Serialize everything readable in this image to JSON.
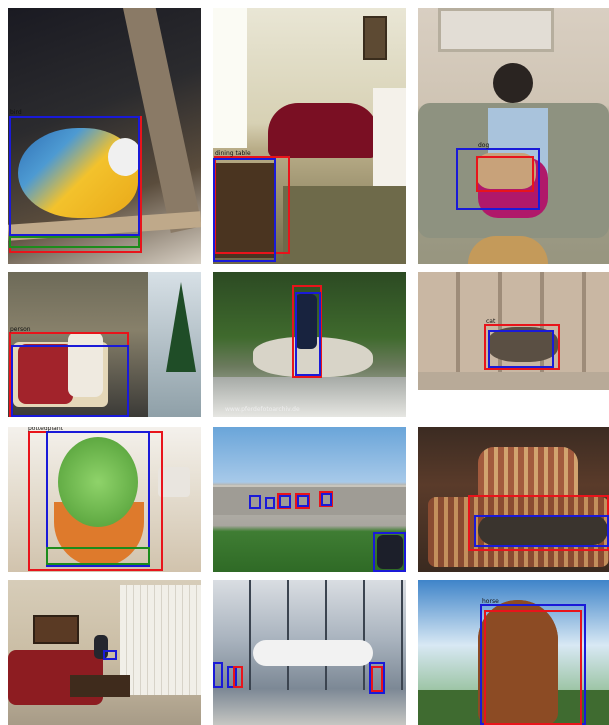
{
  "colors": {
    "prediction_box": "#e8141b",
    "ground_truth_box": "#1a1ad8",
    "green_box": "#1c8c1c"
  },
  "panels": [
    {
      "label": "bird",
      "boxes": [
        {
          "color": "red"
        },
        {
          "color": "blue"
        },
        {
          "color": "green"
        }
      ]
    },
    {
      "label": "dining table",
      "boxes": [
        {
          "color": "red"
        },
        {
          "color": "blue"
        }
      ]
    },
    {
      "label": "dog",
      "boxes": [
        {
          "color": "blue"
        },
        {
          "color": "red"
        }
      ]
    },
    {
      "label": "person",
      "boxes": [
        {
          "color": "red"
        },
        {
          "color": "blue"
        }
      ]
    },
    {
      "label": "person",
      "boxes": [
        {
          "color": "red"
        },
        {
          "color": "blue"
        }
      ]
    },
    {
      "label": "cat",
      "boxes": [
        {
          "color": "red"
        },
        {
          "color": "blue"
        }
      ]
    },
    {
      "label": "pottedplant",
      "boxes": [
        {
          "color": "red"
        },
        {
          "color": "blue"
        },
        {
          "color": "green"
        }
      ]
    },
    {
      "label": "",
      "boxes": [
        {
          "color": "blue"
        },
        {
          "color": "red"
        }
      ]
    },
    {
      "label": "",
      "boxes": [
        {
          "color": "red"
        },
        {
          "color": "blue"
        }
      ]
    },
    {
      "label": "",
      "boxes": [
        {
          "color": "blue"
        }
      ]
    },
    {
      "label": "",
      "boxes": [
        {
          "color": "blue"
        },
        {
          "color": "red"
        }
      ]
    },
    {
      "label": "horse",
      "boxes": [
        {
          "color": "blue"
        },
        {
          "color": "red"
        }
      ]
    }
  ],
  "watermark": "www.pferdefotoarchiv.de"
}
